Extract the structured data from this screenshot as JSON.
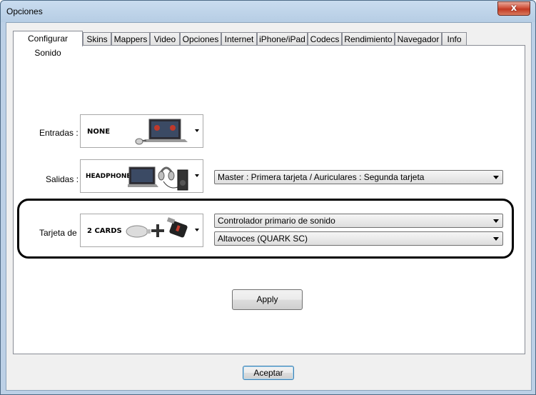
{
  "window": {
    "title": "Opciones",
    "close_glyph": "x"
  },
  "tabs": [
    {
      "label": "Configurar Sonido",
      "active": true
    },
    {
      "label": "Skins"
    },
    {
      "label": "Mappers"
    },
    {
      "label": "Video"
    },
    {
      "label": "Opciones"
    },
    {
      "label": "Internet"
    },
    {
      "label": "iPhone/iPad"
    },
    {
      "label": "Codecs"
    },
    {
      "label": "Rendimiento"
    },
    {
      "label": "Navegador"
    },
    {
      "label": "Info"
    }
  ],
  "inputs_row": {
    "label": "Entradas :",
    "combo_text": "NONE",
    "icon": "laptop-with-mouse"
  },
  "outputs_row": {
    "label": "Salidas :",
    "combo_text": "HEADPHONES",
    "icon": "laptop-headphones-speaker",
    "select_value": "Master : Primera tarjeta / Auriculares : Segunda tarjeta"
  },
  "card_row": {
    "label": "Tarjeta de",
    "combo_text": "2 CARDS",
    "icon": "soundcard-plus-usb",
    "select1_value": "Controlador primario de sonido",
    "select2_value": "Altavoces (QUARK SC)"
  },
  "apply_button": "Apply",
  "accept_button": "Aceptar",
  "colors": {
    "title_bg": "#bcd0e6",
    "close_red": "#c13a23",
    "highlight_border": "#000000"
  }
}
